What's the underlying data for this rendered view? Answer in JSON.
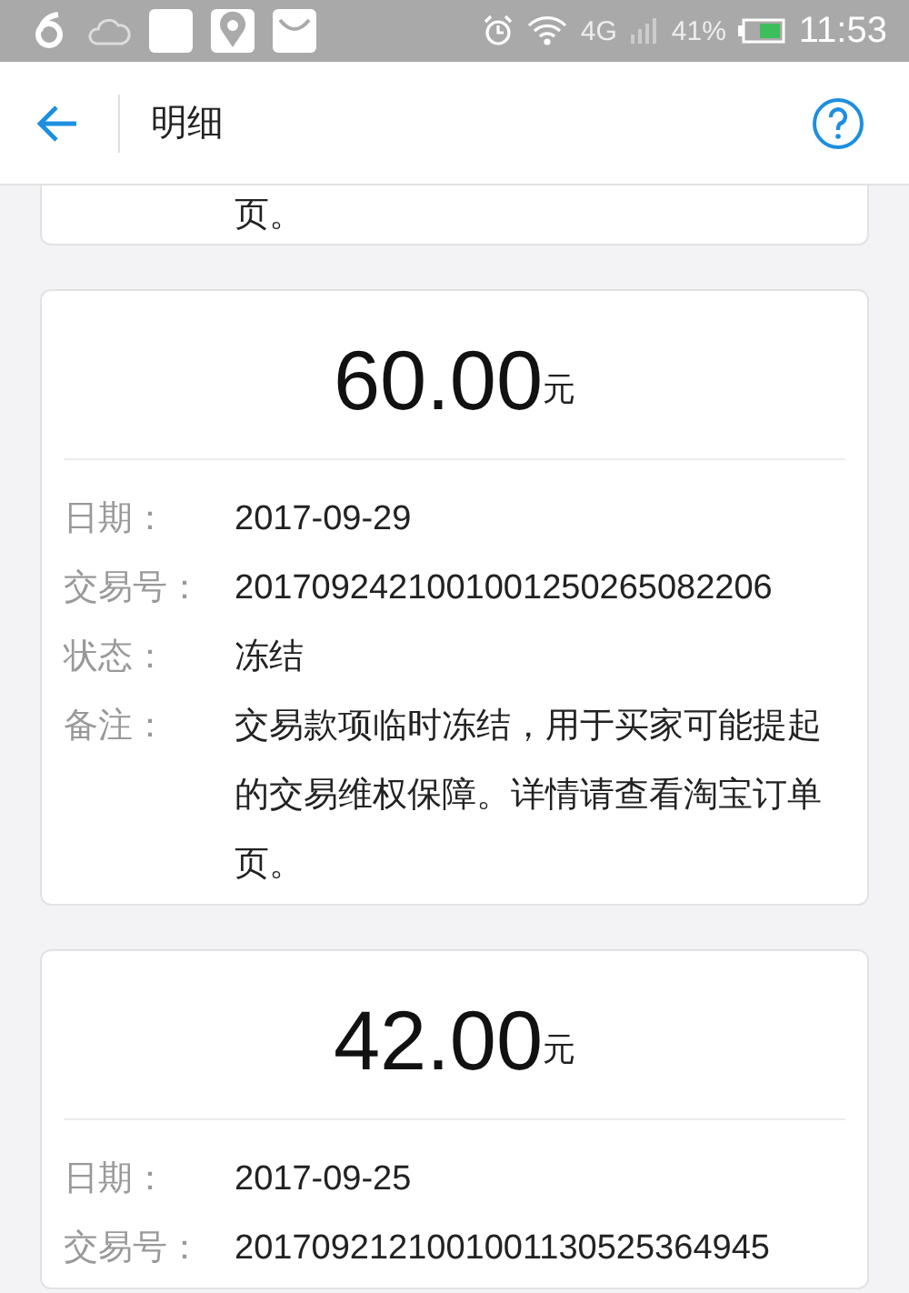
{
  "status_bar": {
    "network": "4G",
    "battery": "41%",
    "time": "11:53"
  },
  "header": {
    "title": "明细"
  },
  "records": [
    {
      "fields": [
        {
          "value": "页。"
        }
      ]
    },
    {
      "amount": "60.00",
      "unit": "元",
      "fields": [
        {
          "label": "日期：",
          "value": "2017-09-29"
        },
        {
          "label": "交易号：",
          "value": "2017092421001001250265082206"
        },
        {
          "label": "状态：",
          "value": "冻结"
        },
        {
          "label": "备注：",
          "value": "交易款项临时冻结，用于买家可能提起的交易维权保障。详情请查看淘宝订单页。"
        }
      ]
    },
    {
      "amount": "42.00",
      "unit": "元",
      "fields": [
        {
          "label": "日期：",
          "value": "2017-09-25"
        },
        {
          "label": "交易号：",
          "value": "2017092121001001130525364945"
        }
      ]
    }
  ]
}
